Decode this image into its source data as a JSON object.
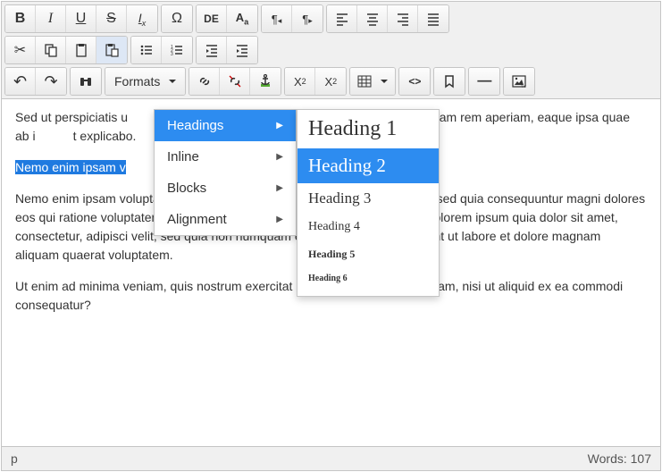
{
  "toolbar": {
    "bold": "B",
    "italic": "I",
    "underline": "U",
    "strike": "S",
    "clearfmt": "Ix",
    "specialchar": "Ω",
    "lang": "DE",
    "transform": "Aa",
    "ltr": "¶‹",
    "rtl": "¶›",
    "alignleft": "≡",
    "aligncenter": "≡",
    "alignright": "≡",
    "alignjustify": "≡",
    "cut": "✂",
    "copy": "⿻",
    "paste": "📋",
    "pastetext": "📋",
    "bullets": "•─",
    "numbers": "1─",
    "outdent": "⇤",
    "indent": "⇥",
    "undo": "↶",
    "redo": "↷",
    "find": "⌕",
    "formats": "Formats",
    "link": "🔗",
    "unlink": "⛓",
    "anchoricon": "⚓",
    "superscript": "X²",
    "subscript": "X₂",
    "table": "▦",
    "code": "<>",
    "bookmark": "🔖",
    "hr": "—",
    "image": "🖼"
  },
  "menu": {
    "headings": "Headings",
    "inline": "Inline",
    "blocks": "Blocks",
    "alignment": "Alignment",
    "h1": "Heading 1",
    "h2": "Heading 2",
    "h3": "Heading 3",
    "h4": "Heading 4",
    "h5": "Heading 5",
    "h6": "Heading 6"
  },
  "body": {
    "p1a": "Sed ut perspiciatis u",
    "p1b": "nque laudantium, totam rem aperiam, eaque ipsa quae ab i",
    "p1c": "t explicabo.",
    "p2sel": "Nemo enim ipsam v",
    "p3": "Nemo enim ipsam voluptatem quia voluptas sit aspernatur aut odit aut fugit, sed quia consequuntur magni dolores eos qui ratione voluptatem sequi nesciunt. Neque porro quisquam est, qui dolorem ipsum quia dolor sit amet, consectetur, adipisci velit, sed quia non numquam eius modi tempora incidunt ut labore et dolore magnam aliquam quaerat voluptatem.",
    "p4a": "Ut enim ad minima veniam, quis nostrum exercitat",
    "p4b": " boriosam, nisi ut aliquid ex ea commodi consequatur?"
  },
  "status": {
    "path": "p",
    "words_label": "Words:",
    "words_count": "107"
  }
}
